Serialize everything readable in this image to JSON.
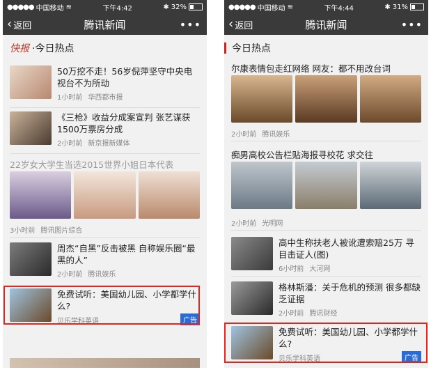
{
  "left": {
    "status": {
      "carrier": "中国移动",
      "time": "下午4:42",
      "battery": "32%",
      "battery_level": 0.32
    },
    "nav": {
      "back": "返回",
      "title": "腾讯新闻",
      "more": "•••"
    },
    "section": {
      "logo": "快报",
      "title": "·今日热点"
    },
    "items": [
      {
        "title": "50万挖不走！56岁倪萍坚守中央电视台不为所动",
        "time": "1小时前",
        "source": "华西都市报"
      },
      {
        "title": "《三枪》收益分成案宣判 张艺谋获1500万票房分成",
        "time": "2小时前",
        "source": "新京报新媒体"
      }
    ],
    "gallery": {
      "title": "22岁女大学生当选2015世界小姐日本代表",
      "time": "3小时前",
      "source": "腾讯图片综合"
    },
    "item3": {
      "title": "周杰“自黑”反击被黑 自称娱乐圈“最黑的人”",
      "time": "2小时前",
      "source": "腾讯娱乐"
    },
    "ad": {
      "title": "免费试听：美国幼儿园、小学都学什么?",
      "source": "贝乐学科英语",
      "badge": "广告"
    }
  },
  "right": {
    "status": {
      "carrier": "中国移动",
      "time": "下午4:44",
      "battery": "31%",
      "battery_level": 0.31
    },
    "nav": {
      "back": "返回",
      "title": "腾讯新闻",
      "more": "•••"
    },
    "section": {
      "title": "今日热点"
    },
    "gallery1": {
      "title": "尔康表情包走红网络 网友：都不用改台词",
      "time": "2小时前",
      "source": "腾讯娱乐"
    },
    "gallery2": {
      "title": "痴男高校公告栏贴海报寻校花 求交往",
      "time": "2小时前",
      "source": "光明网"
    },
    "items": [
      {
        "title": "高中生称扶老人被讹遭索赔25万 寻目击证人(图)",
        "time": "6小时前",
        "source": "大河网"
      },
      {
        "title": "格林斯潘：关于危机的预测 很多都缺乏证据",
        "time": "2小时前",
        "source": "腾讯财经"
      }
    ],
    "ad": {
      "title": "免费试听：美国幼儿园、小学都学什么?",
      "source": "贝乐学科英语",
      "badge": "广告"
    }
  }
}
